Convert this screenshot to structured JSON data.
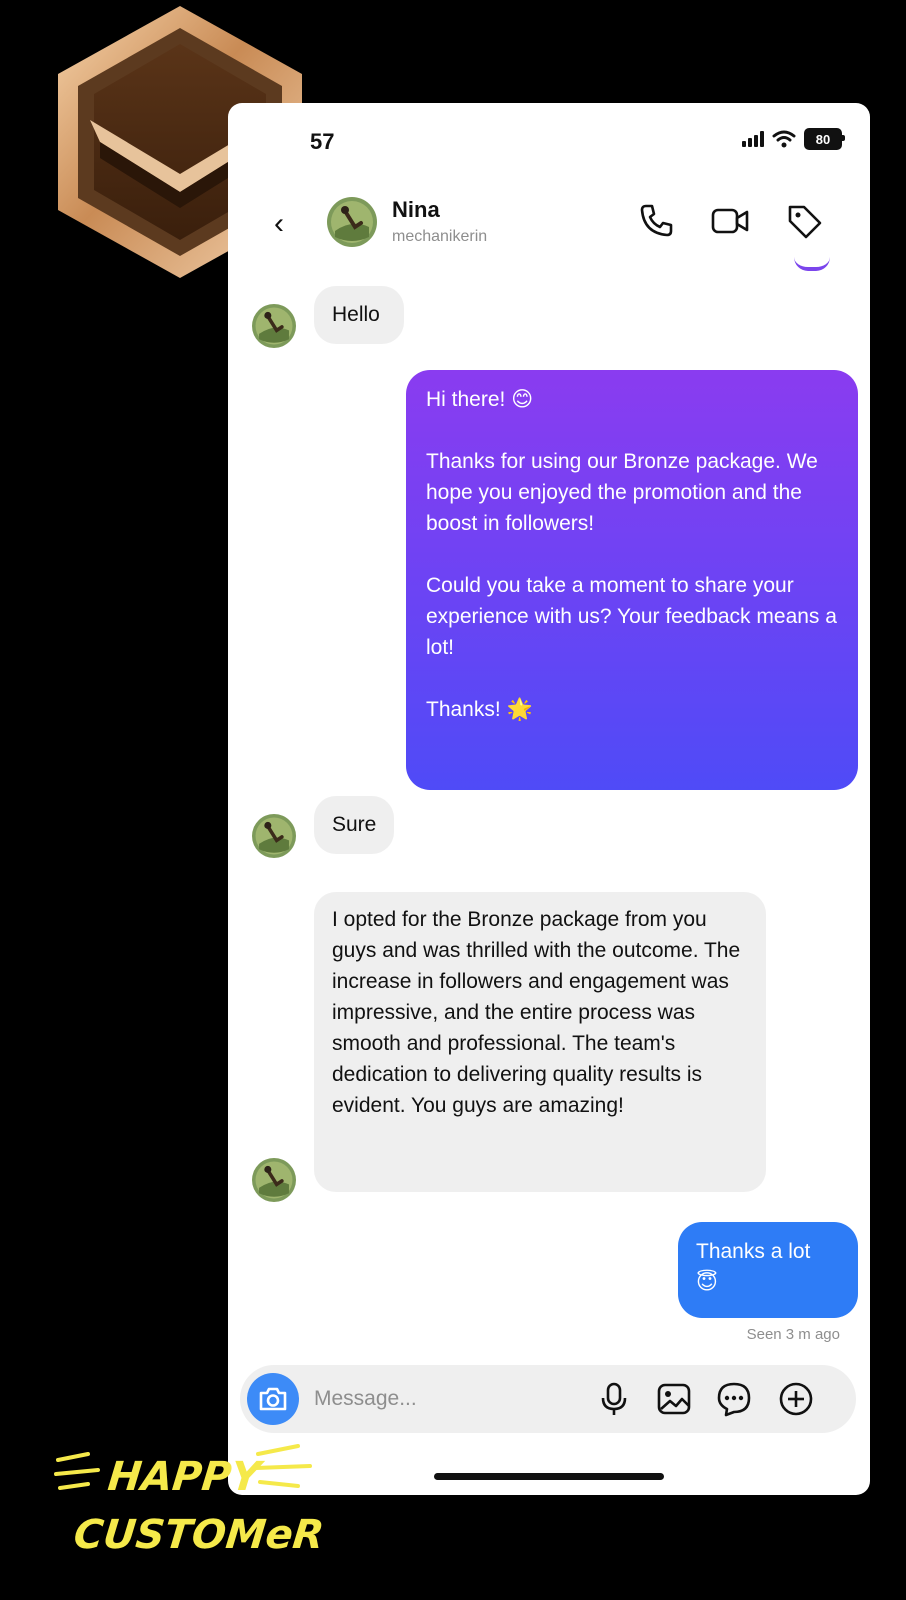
{
  "status": {
    "time": "57",
    "battery": "80"
  },
  "contact": {
    "name": "Nina",
    "username": "mechanikerin"
  },
  "messages": {
    "m1": "Hello",
    "m2_p1": "Hi there! 😊",
    "m2_p2": "Thanks for using our Bronze package. We hope you enjoyed the promotion and the boost in followers!",
    "m2_p3": "Could you take a moment to share your experience with us? Your feedback means a lot!",
    "m2_p4": "Thanks! 🌟",
    "m3": "Sure",
    "m4": "I opted for the Bronze package from you guys and was thrilled with the outcome. The increase in followers and engagement was impressive, and the entire process was smooth and professional. The team's dedication to delivering quality results is evident. You guys are amazing!",
    "m5_p1": "Thanks a lot",
    "m5_p2": "😇"
  },
  "seen": "Seen 3 m ago",
  "composer": {
    "placeholder": "Message..."
  },
  "overlay": {
    "line1": "HAPPY",
    "line2": "CUSTOMeR"
  },
  "colors": {
    "gradient_top": "#8a3cf0",
    "gradient_bottom": "#4f4bf7",
    "blue_bubble": "#2e7cf6",
    "camera": "#3d8bf7",
    "incoming_bubble": "#efefef",
    "overlay_text": "#f5e94a"
  },
  "icons": [
    "back-icon",
    "phone-icon",
    "video-icon",
    "tag-icon",
    "camera-icon",
    "microphone-icon",
    "gallery-icon",
    "sticker-icon",
    "plus-icon",
    "bronze-badge-icon"
  ]
}
